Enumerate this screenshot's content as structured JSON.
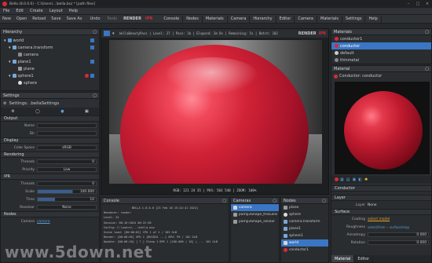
{
  "window": {
    "title": "Bella (8.0.0.0) - C:\\Users\\...\\bella.bsz * [path files]"
  },
  "menu": [
    "File",
    "Edit",
    "Create",
    "Layout",
    "Help"
  ],
  "toolbar": {
    "items": [
      "New",
      "Open",
      "Reload",
      "Save",
      "Save As",
      "Undo",
      "Redo"
    ],
    "render": "RENDER",
    "ipr": "IPR"
  },
  "main_tabs": [
    "Console",
    "Nodes",
    "Materials",
    "Camera",
    "Hierarchy",
    "Editor",
    "Camera",
    "Materials",
    "Settings",
    "Help"
  ],
  "hierarchy": {
    "title": "Hierarchy",
    "items": [
      {
        "label": "world",
        "depth": 0
      },
      {
        "label": "camera.transform",
        "depth": 1
      },
      {
        "label": "camera",
        "depth": 2
      },
      {
        "label": "plane1",
        "depth": 1
      },
      {
        "label": "plane",
        "depth": 2
      },
      {
        "label": "sphere1",
        "depth": 1
      },
      {
        "label": "sphere",
        "depth": 2
      }
    ]
  },
  "settings": {
    "title": "Settings",
    "header": "Settings: .bellaSettings",
    "sections": [
      "Output",
      "Display",
      "Rendering",
      "IPR",
      "Nodes"
    ],
    "fields": [
      {
        "label": "Name",
        "value": ""
      },
      {
        "label": "Dir",
        "value": ""
      },
      {
        "label": "Color Space",
        "value": "sRGB"
      },
      {
        "label": "Threads",
        "value": "0"
      },
      {
        "label": "Priority",
        "value": "Low"
      },
      {
        "label": "Threads",
        "value": "0"
      },
      {
        "label": "Scale",
        "value": "100.000"
      },
      {
        "label": "Time",
        "value": "10"
      },
      {
        "label": "Resolver",
        "value": "None"
      }
    ],
    "camera": {
      "label": "Camera",
      "value": "camera"
    }
  },
  "viewport": {
    "status": "bellaBeautyPass | Level: 27 | Pass: 1b | Elapsed: 2m 8s | Remaining: 5s | Batch: 102",
    "footer": "RGB: 121 24 35  |  POS: 503 540  |  ZOOM: 100%"
  },
  "console": {
    "title": "Console",
    "lines": [
      "BELLA 1.0.0.0 [23 Feb 18 15:22:41 2024]",
      "Renderer:    render",
      "Level:       24",
      "Session:     00:16:2024 00:22:30",
      "Config:      C:\\users\\...\\bella.bsz",
      "Scene load:  [00:00:02] CPU 1 of 2 / 103 GiB",
      "Render:      [00:00:05] GPU 1 [NVIDIA ...] GPU: 99 / 102 GiB",
      "Update:      [00:00:10] [ ? ] Sleep 1 BPS 1 [100.000 / 10] | ... 101 GiB"
    ]
  },
  "cameras": {
    "title": "Cameras",
    "items": [
      "camera",
      "pamp3Shape_thisLens",
      "pamp3Shape_sensor"
    ]
  },
  "nodes": {
    "title": "Nodes",
    "items": [
      "plane",
      "sphere",
      "camera.transform",
      "plane1",
      "sphere1",
      "world",
      "conductor1"
    ]
  },
  "materials": {
    "title": "Materials",
    "items": [
      "conductor1",
      "conductor",
      "default",
      "thinmetal"
    ]
  },
  "material": {
    "title": "Material",
    "header": "Conductor: conductor",
    "sections": [
      "Conductor",
      "Layer",
      "Surface"
    ],
    "fields": [
      {
        "label": "Layer",
        "value": "None"
      },
      {
        "label": "Coating",
        "value": "select model"
      },
      {
        "label": "Roughness",
        "value": "select/from -- surface/map"
      },
      {
        "label": "Anisotropy",
        "value": "0.000"
      },
      {
        "label": "Rotation",
        "value": "0.000"
      }
    ]
  },
  "bottom_tabs": {
    "left": "Material",
    "right": "Editor"
  },
  "watermark": "www.5down.net",
  "colors": {
    "accent": "#3a76c4",
    "red": "#d82a3a",
    "panel": "#2a2d30"
  }
}
